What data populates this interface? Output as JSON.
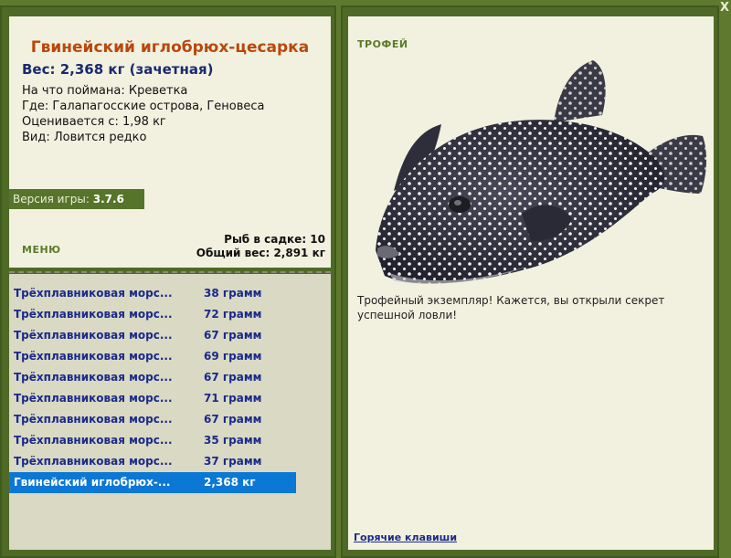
{
  "catch_detail": {
    "title": "Гвинейский иглобрюх-цесарка",
    "weight": "Вес: 2,368 кг (зачетная)",
    "bait": "На что поймана: Креветка",
    "location": "Где: Галапагосские острова, Геновеса",
    "valued_from": "Оценивается с: 1,98 кг",
    "rarity": "Вид: Ловится редко"
  },
  "version": {
    "label": "Версия игры:",
    "value": "3.7.6"
  },
  "menu_label": "МЕНЮ",
  "keep_net": {
    "fish_count": "Рыб в садке: 10",
    "total_weight": "Общий вес: 2,891 кг"
  },
  "catch_list": [
    {
      "name": "Трёхплавниковая морс...",
      "weight": "38 грамм"
    },
    {
      "name": "Трёхплавниковая морс...",
      "weight": "72 грамм"
    },
    {
      "name": "Трёхплавниковая морс...",
      "weight": "67 грамм"
    },
    {
      "name": "Трёхплавниковая морс...",
      "weight": "69 грамм"
    },
    {
      "name": "Трёхплавниковая морс...",
      "weight": "67 грамм"
    },
    {
      "name": "Трёхплавниковая морс...",
      "weight": "71 грамм"
    },
    {
      "name": "Трёхплавниковая морс...",
      "weight": "67 грамм"
    },
    {
      "name": "Трёхплавниковая морс...",
      "weight": "35 грамм"
    },
    {
      "name": "Трёхплавниковая морс...",
      "weight": "37 грамм"
    },
    {
      "name": "Гвинейский иглобрюх-...",
      "weight": "2,368 кг",
      "selected": true
    }
  ],
  "trophy": {
    "label": "ТРОФЕЙ",
    "text": "Трофейный экземпляр! Кажется, вы открыли секрет успешной ловли!"
  },
  "hotkeys_link": "Горячие клавиши",
  "close_glyph": "X",
  "colors": {
    "background": "#5f7a2e",
    "panel": "#f2f1e0",
    "list_panel": "#d9d9c4",
    "title": "#b8480c",
    "link": "#1a2a8a",
    "selection": "#0a78d4"
  }
}
